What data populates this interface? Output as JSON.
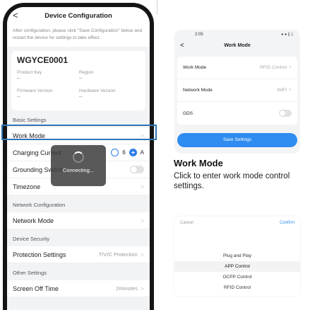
{
  "phone": {
    "title": "Device Configuration",
    "back": "<",
    "notice": "After configuration, please click \"Save Configuration\" below and restart the device for settings to take effect.",
    "device": {
      "name": "WGYCE0001",
      "product_key_label": "Product Key",
      "product_key_value": "--",
      "region_label": "Region",
      "region_value": "--",
      "firmware_label": "Firmware Version",
      "firmware_value": "--",
      "hardware_label": "Hardware Version",
      "hardware_value": "--"
    },
    "basic_settings": {
      "title": "Basic Settings",
      "work_mode": "Work Mode",
      "charging_current": "Charging Current",
      "charging_current_value": "6",
      "charging_current_unit": "A",
      "grounding_switch": "Grounding Switch",
      "timezone": "Timezone"
    },
    "network_configuration": {
      "title": "Network Configuration",
      "network_mode": "Network Mode"
    },
    "device_security": {
      "title": "Device Security",
      "protection_settings": "Protection Settings",
      "protection_value": "T/V/C Protection"
    },
    "other_settings": {
      "title": "Other Settings",
      "screen_off_time": "Screen Off Time",
      "screen_off_value": "2minutes"
    },
    "toast": "Connecting..."
  },
  "mini": {
    "time": "2:05",
    "status_icons": "● ● ∥ ▯",
    "back": "<",
    "title": "Work Mode",
    "rows": [
      {
        "label": "Work Mode",
        "value": "RFID Control"
      },
      {
        "label": "Network Mode",
        "value": "WIFI"
      },
      {
        "label": "GDS",
        "value": ""
      }
    ],
    "save_button": "Save Settings"
  },
  "description": {
    "title": "Work Mode",
    "body": "Click to enter work mode control settings."
  },
  "picker": {
    "cancel": "Cancel",
    "confirm": "Confirm",
    "options": [
      "Plug and Play",
      "APP Control",
      "OCPP Control",
      "RFID Control"
    ],
    "selected_index": 1
  },
  "colors": {
    "accent": "#2f8cf0",
    "highlight": "#2f75b6",
    "phone_frame": "#151515"
  }
}
